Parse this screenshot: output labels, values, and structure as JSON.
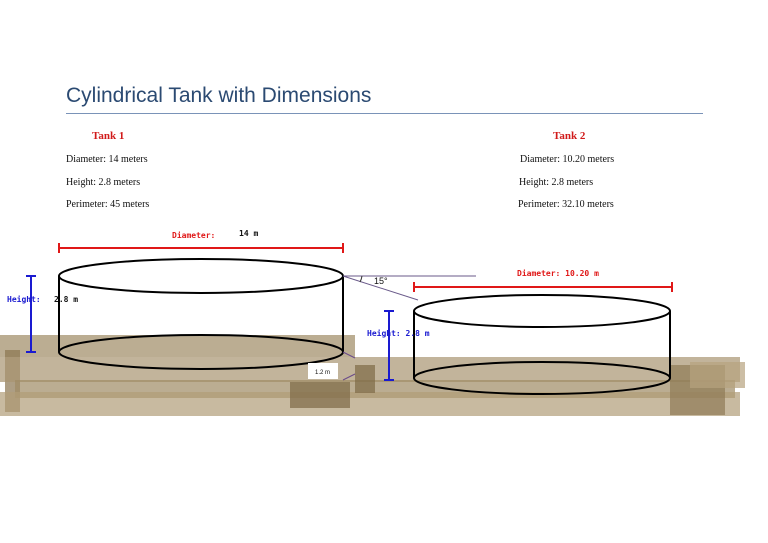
{
  "page_title": "Cylindrical Tank with Dimensions",
  "tank1": {
    "label": "Tank 1",
    "diameter_text": "Diameter: 14 meters",
    "height_text": "Height: 2.8 meters",
    "perimeter_text": "Perimeter: 45 meters"
  },
  "tank2": {
    "label": "Tank 2",
    "diameter_text": "Diameter: 10.20 meters",
    "height_text": "Height: 2.8 meters",
    "perimeter_text": "Perimeter: 32.10 meters"
  },
  "drawing": {
    "tank1_diameter_label": "Diameter:",
    "tank1_diameter_value": "14 m",
    "tank1_height_label": "Height:",
    "tank1_height_value": "2.8 m",
    "angle_label": "15°",
    "gap_label": "1.2 m",
    "tank2_diameter_label": "Diameter: 10.20 m",
    "tank2_height_label": "Height: 2.8 m"
  },
  "colors": {
    "title": "#2b4a72",
    "red_dimension": "#e01818",
    "blue_dimension": "#1a1ad0",
    "ground": "#a08c66"
  }
}
